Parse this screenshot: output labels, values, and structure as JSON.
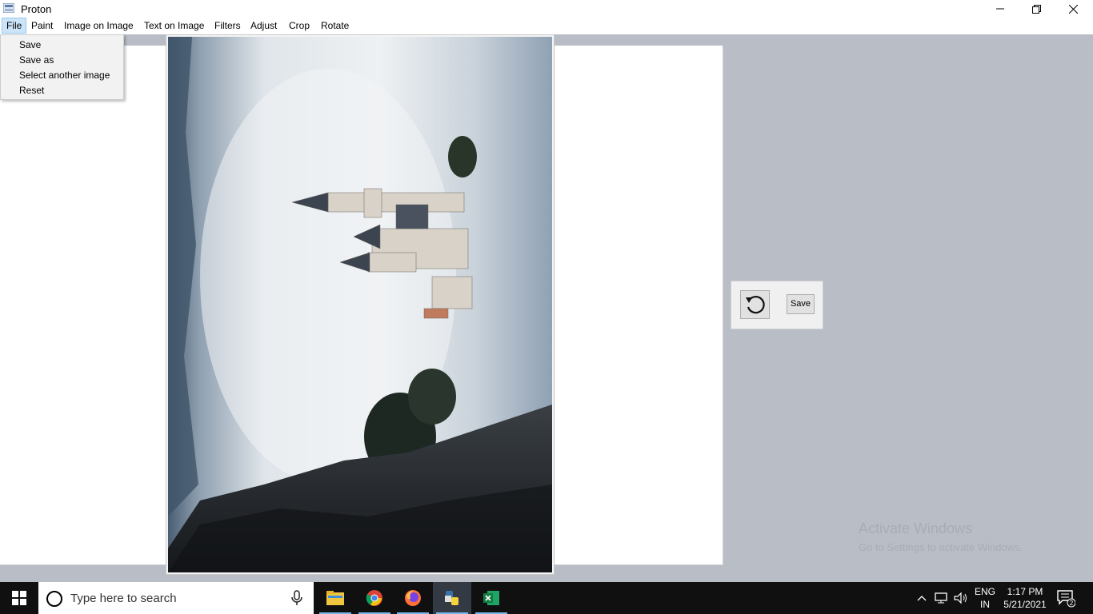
{
  "window": {
    "title": "Proton"
  },
  "menu": [
    {
      "label": "File"
    },
    {
      "label": "Paint"
    },
    {
      "label": "Image on Image"
    },
    {
      "label": "Text on Image"
    },
    {
      "label": "Filters"
    },
    {
      "label": "Adjust"
    },
    {
      "label": "Crop"
    },
    {
      "label": "Rotate"
    }
  ],
  "file_menu": [
    "Save",
    "Save as",
    "Select another image",
    "Reset"
  ],
  "tools": {
    "save_label": "Save",
    "undo_icon": "undo-icon"
  },
  "watermark": {
    "line1": "Activate Windows",
    "line2": "Go to Settings to activate Windows."
  },
  "taskbar": {
    "search_placeholder": "Type here to search",
    "apps": [
      "file-explorer-icon",
      "chrome-icon",
      "firefox-icon",
      "python-icon",
      "excel-icon"
    ],
    "lang_top": "ENG",
    "lang_bottom": "IN",
    "time": "1:17 PM",
    "date": "5/21/2021",
    "notification_count": "2"
  },
  "colors": {
    "accent": "#76b9ed",
    "background": "#b8bdc6",
    "taskbar": "#101010"
  }
}
